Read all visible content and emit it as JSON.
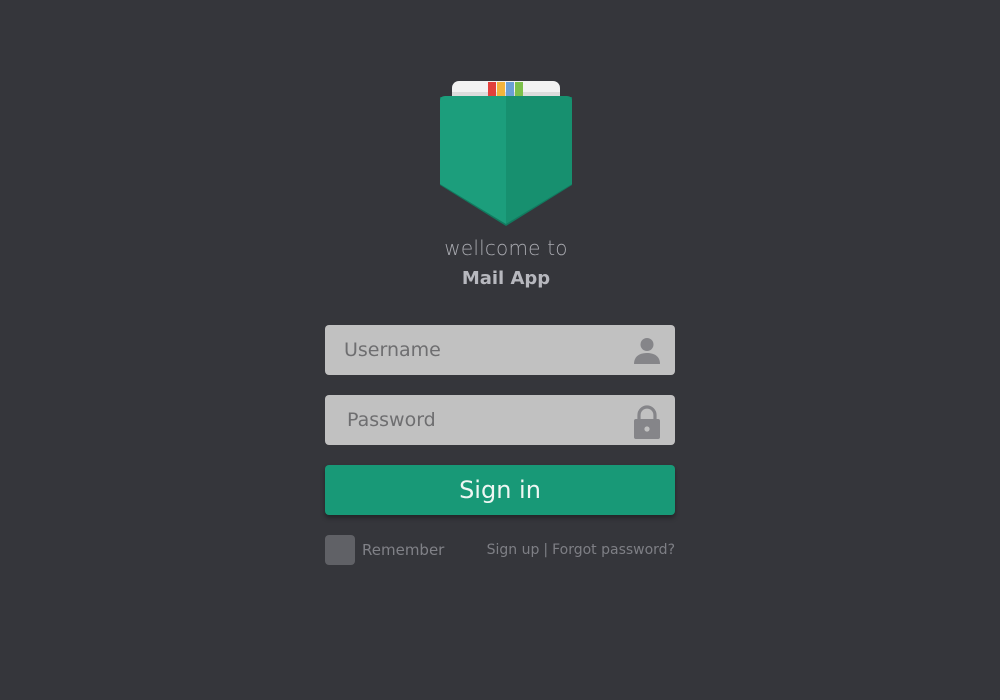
{
  "brand": {
    "welcome_text": "wellcome to",
    "app_name": "Mail App",
    "logo_icon": "mail-pocket-icon",
    "accent_color": "#189977",
    "stripe_colors": [
      "#e2403c",
      "#f2b43d",
      "#6a9fd6",
      "#7cc04b"
    ]
  },
  "login_form": {
    "username": {
      "value": "",
      "placeholder": "Username",
      "icon": "user-icon"
    },
    "password": {
      "value": "",
      "placeholder": "Password",
      "icon": "lock-icon"
    },
    "submit_label": "Sign in",
    "remember": {
      "label": "Remember",
      "checked": false
    },
    "links": {
      "signup": "Sign up",
      "separator": "|",
      "forgot": "Forgot password?"
    }
  },
  "colors": {
    "background": "#35363b",
    "field": "#c1c1c1",
    "muted_text": "#808187"
  }
}
